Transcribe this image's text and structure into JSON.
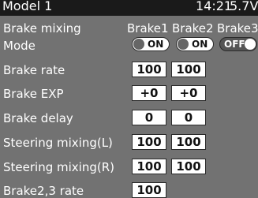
{
  "status": {
    "model_name": "Model 1",
    "time": "14:21",
    "voltage": "5.7V"
  },
  "screen": {
    "title": "Brake mixing",
    "columns": [
      "Brake1",
      "Brake2",
      "Brake3"
    ]
  },
  "rows": {
    "mode": {
      "label": "Mode",
      "brake1": "ON",
      "brake2": "ON",
      "brake3": "OFF"
    },
    "brake_rate": {
      "label": "Brake rate",
      "brake1": "100",
      "brake2": "100"
    },
    "brake_exp": {
      "label": "Brake EXP",
      "brake1": "+0",
      "brake2": "+0"
    },
    "brake_delay": {
      "label": "Brake delay",
      "brake1": "0",
      "brake2": "0"
    },
    "steering_l": {
      "label": "Steering mixing(L)",
      "brake1": "100",
      "brake2": "100"
    },
    "steering_r": {
      "label": "Steering mixing(R)",
      "brake1": "100",
      "brake2": "100"
    },
    "brake23_rate": {
      "label": "Brake2,3 rate",
      "brake1": "100"
    }
  },
  "colors": {
    "background": "#727272",
    "status_bar": "#1a1a1a",
    "value_box": "#ffffff"
  }
}
